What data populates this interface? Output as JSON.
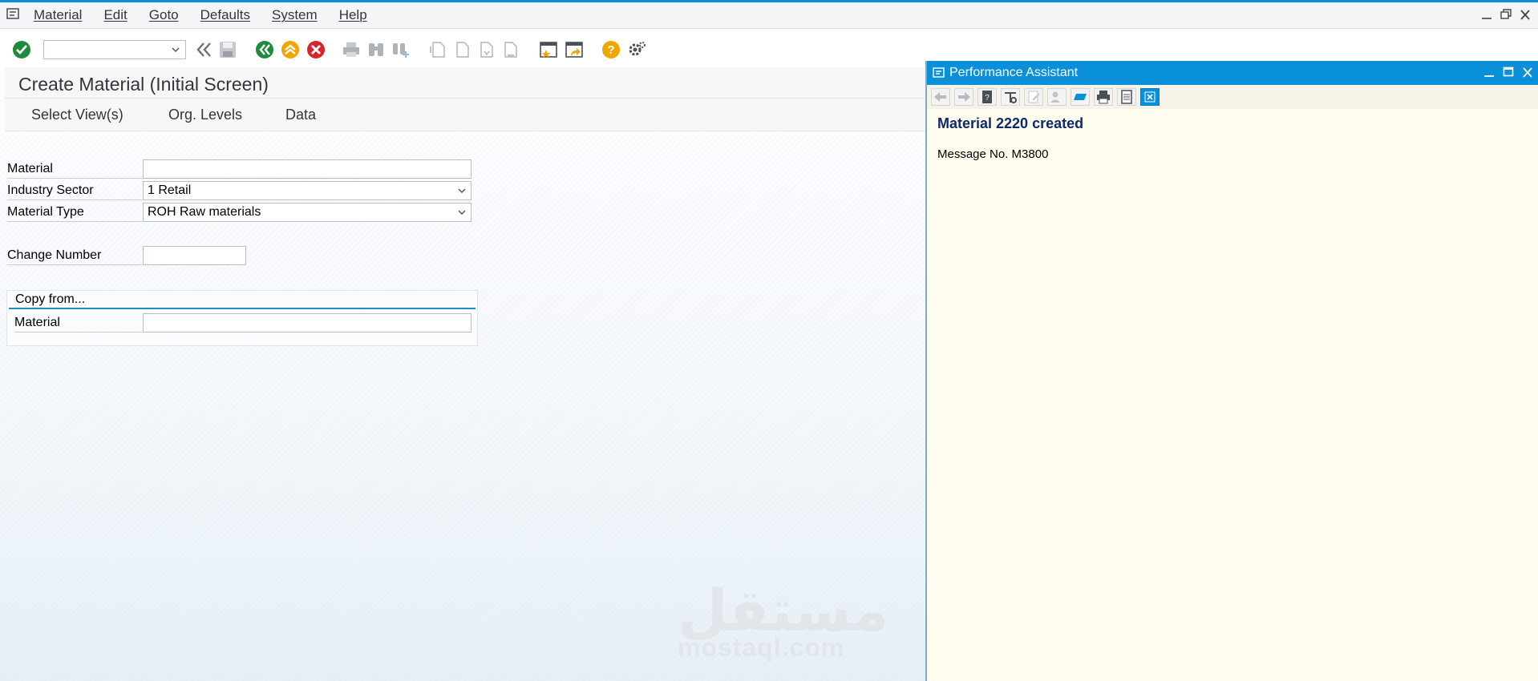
{
  "menubar": {
    "items": [
      "Material",
      "Edit",
      "Goto",
      "Defaults",
      "System",
      "Help"
    ]
  },
  "toolbar": {
    "command_field_value": ""
  },
  "screen": {
    "title": "Create Material (Initial Screen)",
    "app_buttons": [
      "Select View(s)",
      "Org. Levels",
      "Data"
    ]
  },
  "form": {
    "material_label": "Material",
    "material_value": "",
    "industry_sector_label": "Industry Sector",
    "industry_sector_value": "1 Retail",
    "material_type_label": "Material Type",
    "material_type_value": "ROH Raw materials",
    "change_number_label": "Change Number",
    "change_number_value": "",
    "copy_from_title": "Copy from...",
    "copy_material_label": "Material",
    "copy_material_value": ""
  },
  "watermark": {
    "arabic": "مستقل",
    "latin": "mostaql.com"
  },
  "performance_assistant": {
    "title": "Performance Assistant",
    "message_title": "Material 2220 created",
    "message_number": "Message No. M3800"
  },
  "colors": {
    "accent": "#0a8fd9",
    "header_text": "#0f2a6b",
    "ok_green": "#1e8a3c",
    "cancel_red": "#d6262c",
    "help_orange": "#f0a500"
  }
}
